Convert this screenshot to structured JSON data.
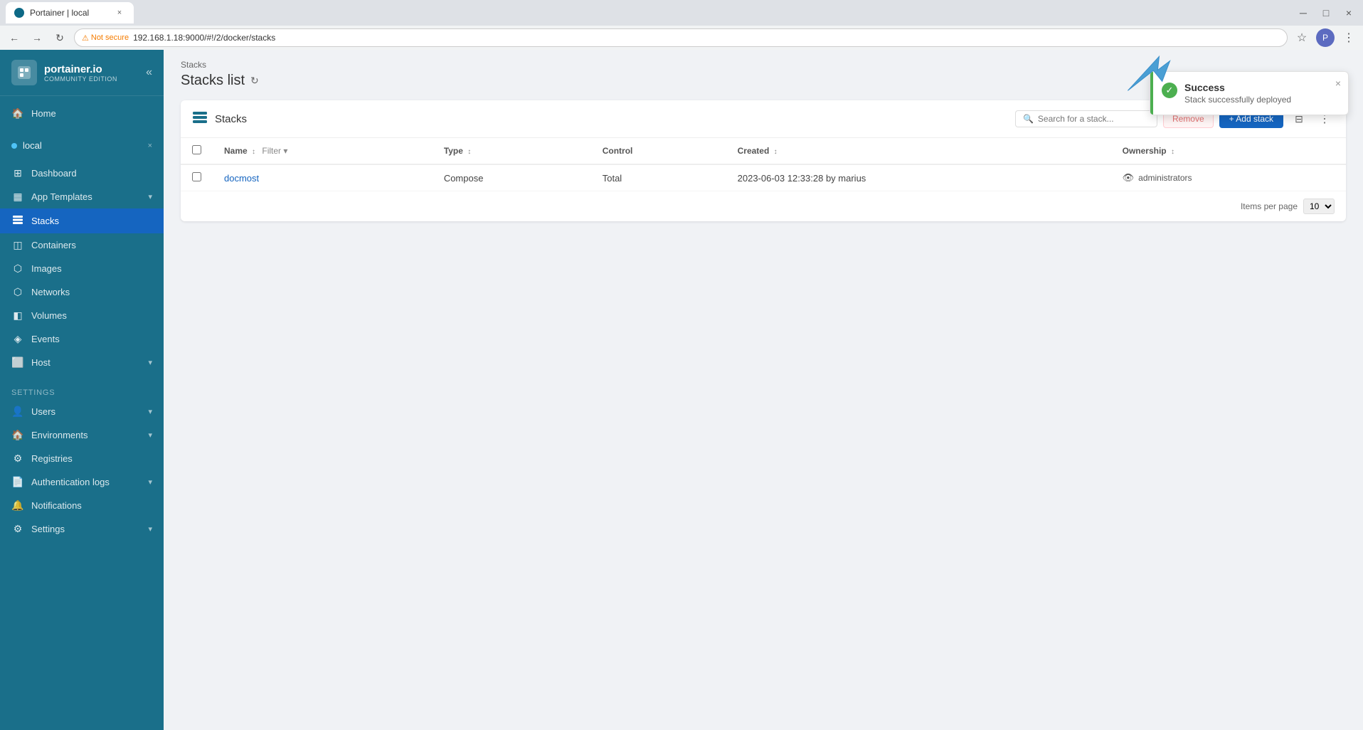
{
  "browser": {
    "tab_title": "Portainer | local",
    "tab_close": "×",
    "address": "192.168.1.18:9000/#!/2/docker/stacks",
    "security_label": "Not secure",
    "nav_back": "←",
    "nav_forward": "→",
    "nav_refresh": "↻"
  },
  "sidebar": {
    "brand_name": "portainer.io",
    "brand_edition": "Community Edition",
    "collapse_label": "«",
    "home_label": "Home",
    "env_name": "local",
    "env_close": "×",
    "nav_items": [
      {
        "id": "dashboard",
        "label": "Dashboard",
        "icon": "⊞"
      },
      {
        "id": "app-templates",
        "label": "App Templates",
        "icon": "▦",
        "has_chevron": true
      },
      {
        "id": "stacks",
        "label": "Stacks",
        "icon": "≡",
        "active": true
      },
      {
        "id": "containers",
        "label": "Containers",
        "icon": "◫"
      },
      {
        "id": "images",
        "label": "Images",
        "icon": "⬡"
      },
      {
        "id": "networks",
        "label": "Networks",
        "icon": "⬡"
      },
      {
        "id": "volumes",
        "label": "Volumes",
        "icon": "◧"
      },
      {
        "id": "events",
        "label": "Events",
        "icon": "◈"
      },
      {
        "id": "host",
        "label": "Host",
        "icon": "⬜",
        "has_chevron": true
      }
    ],
    "settings_label": "Settings",
    "settings_items": [
      {
        "id": "users",
        "label": "Users",
        "icon": "👤",
        "has_chevron": true
      },
      {
        "id": "environments",
        "label": "Environments",
        "icon": "🏠",
        "has_chevron": true
      },
      {
        "id": "registries",
        "label": "Registries",
        "icon": "⚙"
      },
      {
        "id": "auth-logs",
        "label": "Authentication logs",
        "icon": "📄",
        "has_chevron": true
      },
      {
        "id": "notifications",
        "label": "Notifications",
        "icon": "🔔"
      },
      {
        "id": "settings",
        "label": "Settings",
        "icon": "⚙",
        "has_chevron": true
      }
    ]
  },
  "page": {
    "breadcrumb": "Stacks",
    "title": "Stacks list",
    "refresh_tooltip": "Refresh"
  },
  "stacks_card": {
    "title": "Stacks",
    "search_placeholder": "Search for a stack...",
    "remove_label": "Remove",
    "add_stack_label": "+ Add stack",
    "columns": [
      {
        "id": "name",
        "label": "Name",
        "sortable": true
      },
      {
        "id": "type",
        "label": "Type",
        "sortable": true
      },
      {
        "id": "control",
        "label": "Control"
      },
      {
        "id": "created",
        "label": "Created",
        "sortable": true
      },
      {
        "id": "ownership",
        "label": "Ownership",
        "sortable": true
      }
    ],
    "rows": [
      {
        "name": "docmost",
        "type": "Compose",
        "control": "Total",
        "created": "2023-06-03 12:33:28 by marius",
        "ownership": "administrators"
      }
    ],
    "items_per_page_label": "Items per page",
    "items_per_page_value": "10"
  },
  "toast": {
    "title": "Success",
    "message": "Stack successfully deployed",
    "close": "×"
  }
}
